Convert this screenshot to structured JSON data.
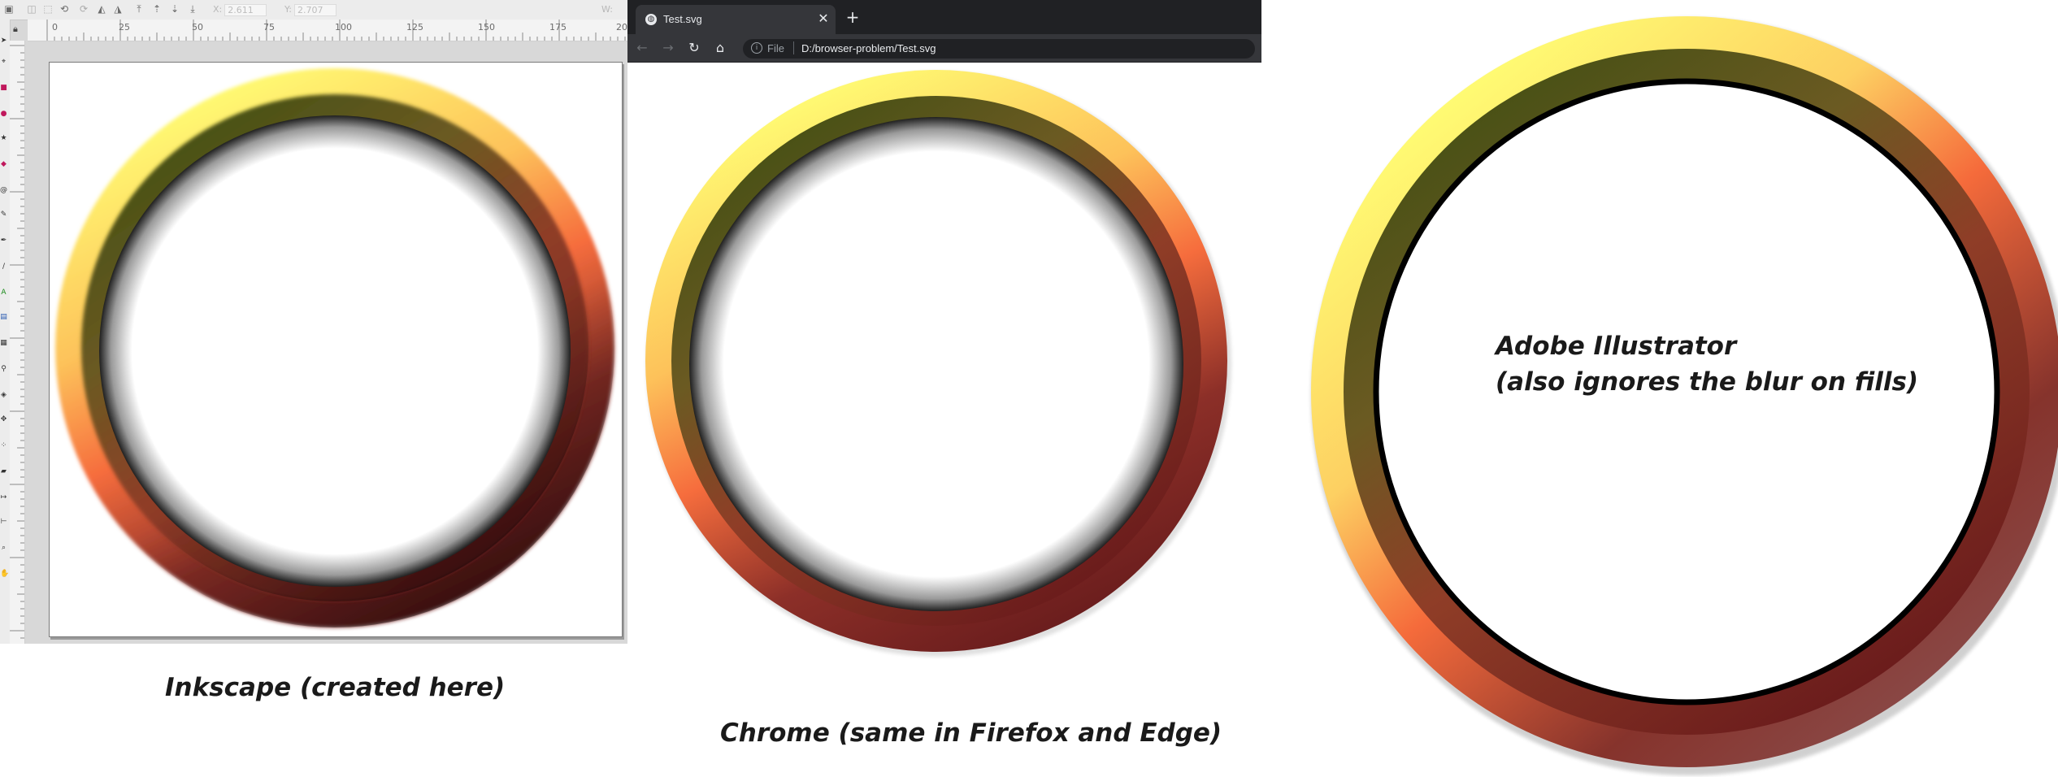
{
  "inkscape": {
    "toolbar": {
      "x_label": "X:",
      "x_value": "2.611",
      "y_label": "Y:",
      "y_value": "2.707",
      "w_label": "W:"
    },
    "ruler_numbers": [
      "0",
      "25",
      "50",
      "75",
      "100",
      "125",
      "150",
      "175",
      "20"
    ],
    "caption": "Inkscape (created here)"
  },
  "chrome": {
    "tab_title": "Test.svg",
    "address_scheme": "File",
    "address_url": "D:/browser-problem/Test.svg",
    "caption": "Chrome (same in Firefox and Edge)"
  },
  "illustrator": {
    "label_line1": "Adobe Illustrator",
    "label_line2": "(also ignores the blur on fills)"
  },
  "colors": {
    "ring_yellow": "#fffb73",
    "ring_orange": "#fb6b3a",
    "ring_darkred": "#7a2220",
    "ring_olive": "#525a18",
    "chrome_dark": "#202124",
    "chrome_tab": "#35363a"
  }
}
